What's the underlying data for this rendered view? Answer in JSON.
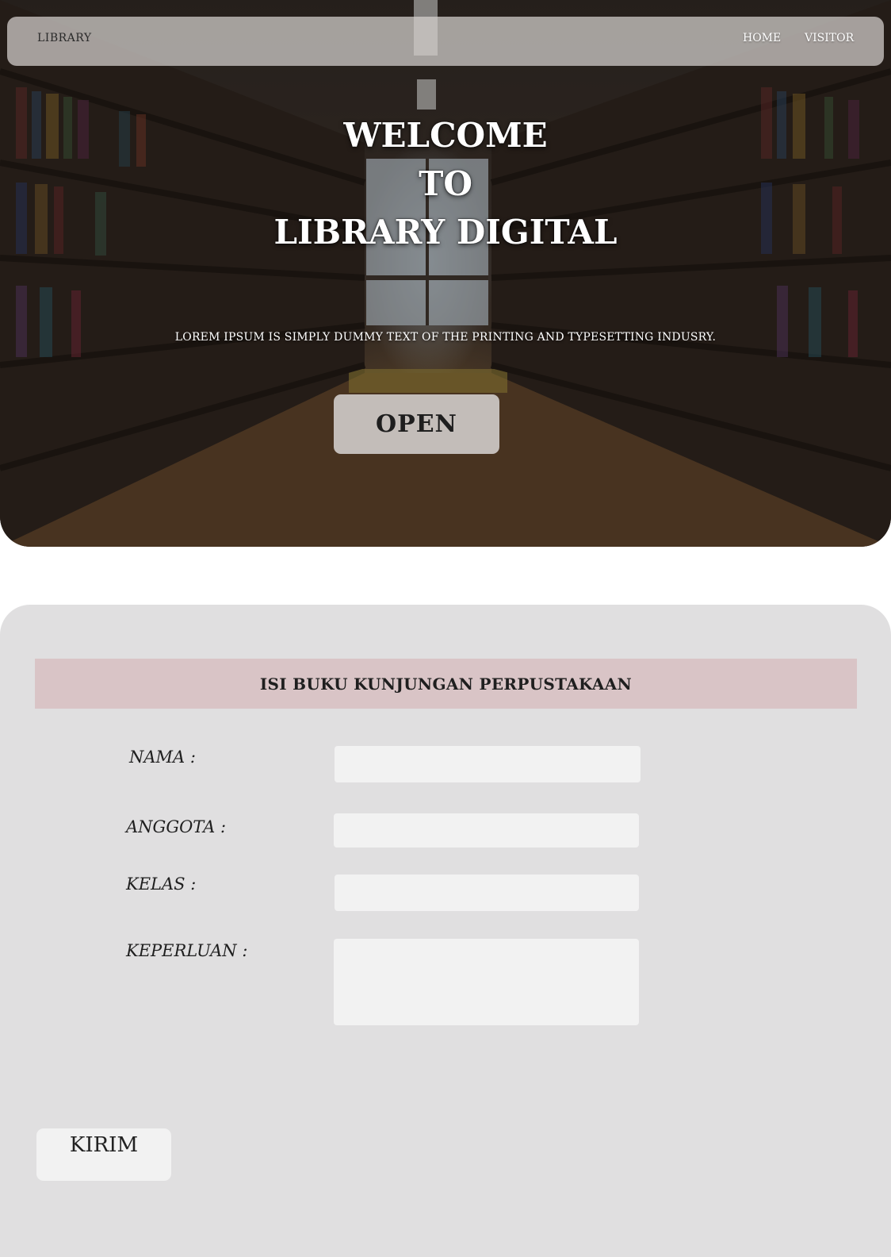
{
  "navbar": {
    "brand": "LIBRARY",
    "links": [
      {
        "label": "HOME"
      },
      {
        "label": "VISITOR"
      }
    ]
  },
  "hero": {
    "title_lines": [
      "WELCOME",
      "TO",
      "LIBRARY DIGITAL"
    ],
    "subtitle": "LOREM IPSUM IS SIMPLY DUMMY TEXT OF THE PRINTING AND TYPESETTING INDUSRY.",
    "open_label": "OPEN"
  },
  "form": {
    "title": "ISI BUKU KUNJUNGAN PERPUSTAKAAN",
    "fields": {
      "nama": {
        "label": "NAMA :",
        "value": ""
      },
      "anggota": {
        "label": "ANGGOTA :",
        "value": ""
      },
      "kelas": {
        "label": "KELAS :",
        "value": ""
      },
      "keperluan": {
        "label": "KEPERLUAN :",
        "value": ""
      }
    },
    "submit_label": "KIRIM"
  },
  "colors": {
    "card_background": "#e0dfe0",
    "header_background": "#d9c4c6",
    "field_background": "#f2f2f2",
    "navbar_background": "rgba(215,210,208,0.72)"
  }
}
